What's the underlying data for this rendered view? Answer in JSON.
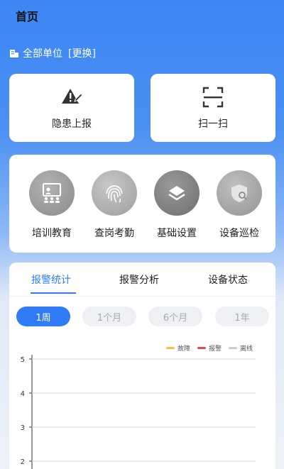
{
  "header": {
    "title": "首页"
  },
  "unit": {
    "name": "全部单位",
    "switch_label": "[更换]"
  },
  "quick_actions": [
    {
      "label": "隐患上报",
      "icon": "hazard-report-icon"
    },
    {
      "label": "扫一扫",
      "icon": "scan-icon"
    }
  ],
  "menu": [
    {
      "label": "培训教育",
      "icon": "training-icon"
    },
    {
      "label": "查岗考勤",
      "icon": "fingerprint-icon"
    },
    {
      "label": "基础设置",
      "icon": "layers-icon"
    },
    {
      "label": "设备巡检",
      "icon": "shield-inspect-icon"
    }
  ],
  "tabs": [
    {
      "label": "报警统计",
      "active": true
    },
    {
      "label": "报警分析",
      "active": false
    },
    {
      "label": "设备状态",
      "active": false
    }
  ],
  "periods": [
    {
      "label": "1周",
      "active": true
    },
    {
      "label": "1个月",
      "active": false
    },
    {
      "label": "6个月",
      "active": false
    },
    {
      "label": "1年",
      "active": false
    }
  ],
  "colors": {
    "accent": "#2f7cf6",
    "fault": "#f5c242",
    "alarm": "#e5484d",
    "offline": "#cccccc"
  },
  "chart_data": {
    "type": "line",
    "title": "",
    "xlabel": "",
    "ylabel": "",
    "ylim": [
      2,
      5
    ],
    "yticks": [
      "5",
      "4",
      "3",
      "2"
    ],
    "grid": true,
    "legend_position": "top-right",
    "series": [
      {
        "name": "故障",
        "color": "#f5c242",
        "values": []
      },
      {
        "name": "报警",
        "color": "#e5484d",
        "values": []
      },
      {
        "name": "离线",
        "color": "#cccccc",
        "values": []
      }
    ]
  }
}
